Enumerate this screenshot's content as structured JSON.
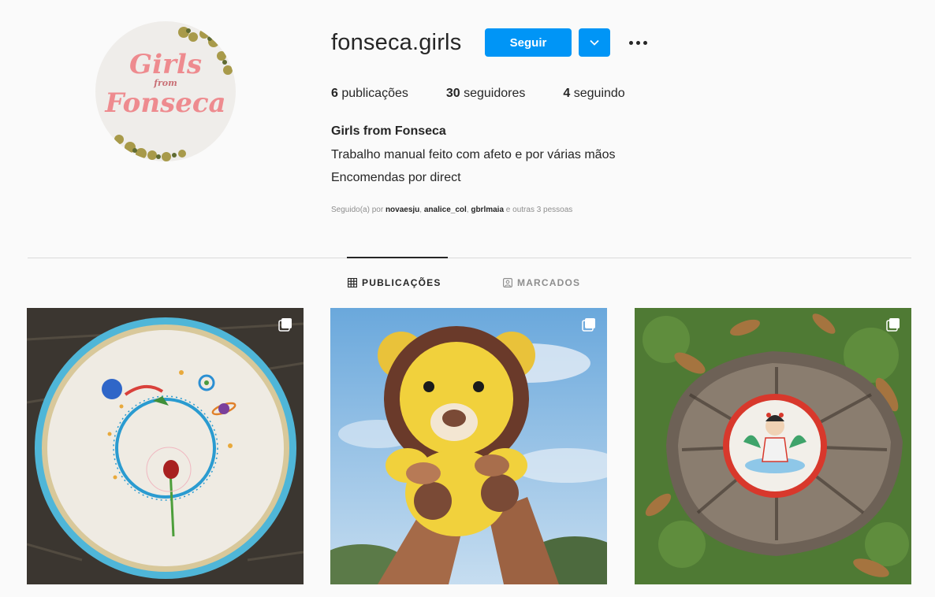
{
  "profile": {
    "username": "fonseca.girls",
    "follow_label": "Seguir",
    "logo": {
      "line1": "Girls",
      "line2": "from",
      "line3": "Fonseca"
    },
    "stats": {
      "posts_count": "6",
      "posts_label": "publicações",
      "followers_count": "30",
      "followers_label": "seguidores",
      "following_count": "4",
      "following_label": "seguindo"
    },
    "full_name": "Girls from Fonseca",
    "bio_line1": "Trabalho manual feito com afeto e por várias mãos",
    "bio_line2": "Encomendas por direct",
    "followed_by": {
      "prefix": "Seguido(a) por ",
      "user1": "novaesju",
      "user2": "analice_col",
      "user3": "gbrlmaia",
      "suffix": " e outras 3 pessoas"
    }
  },
  "tabs": {
    "posts": "PUBLICAÇÕES",
    "tagged": "MARCADOS"
  },
  "colors": {
    "accent": "#0095f6",
    "text": "#262626",
    "muted": "#8e8e8e",
    "divider": "#dbdbdb"
  },
  "posts": [
    {
      "icon": "multiple-posts-icon"
    },
    {
      "icon": "multiple-posts-icon"
    },
    {
      "icon": "multiple-posts-icon"
    }
  ]
}
